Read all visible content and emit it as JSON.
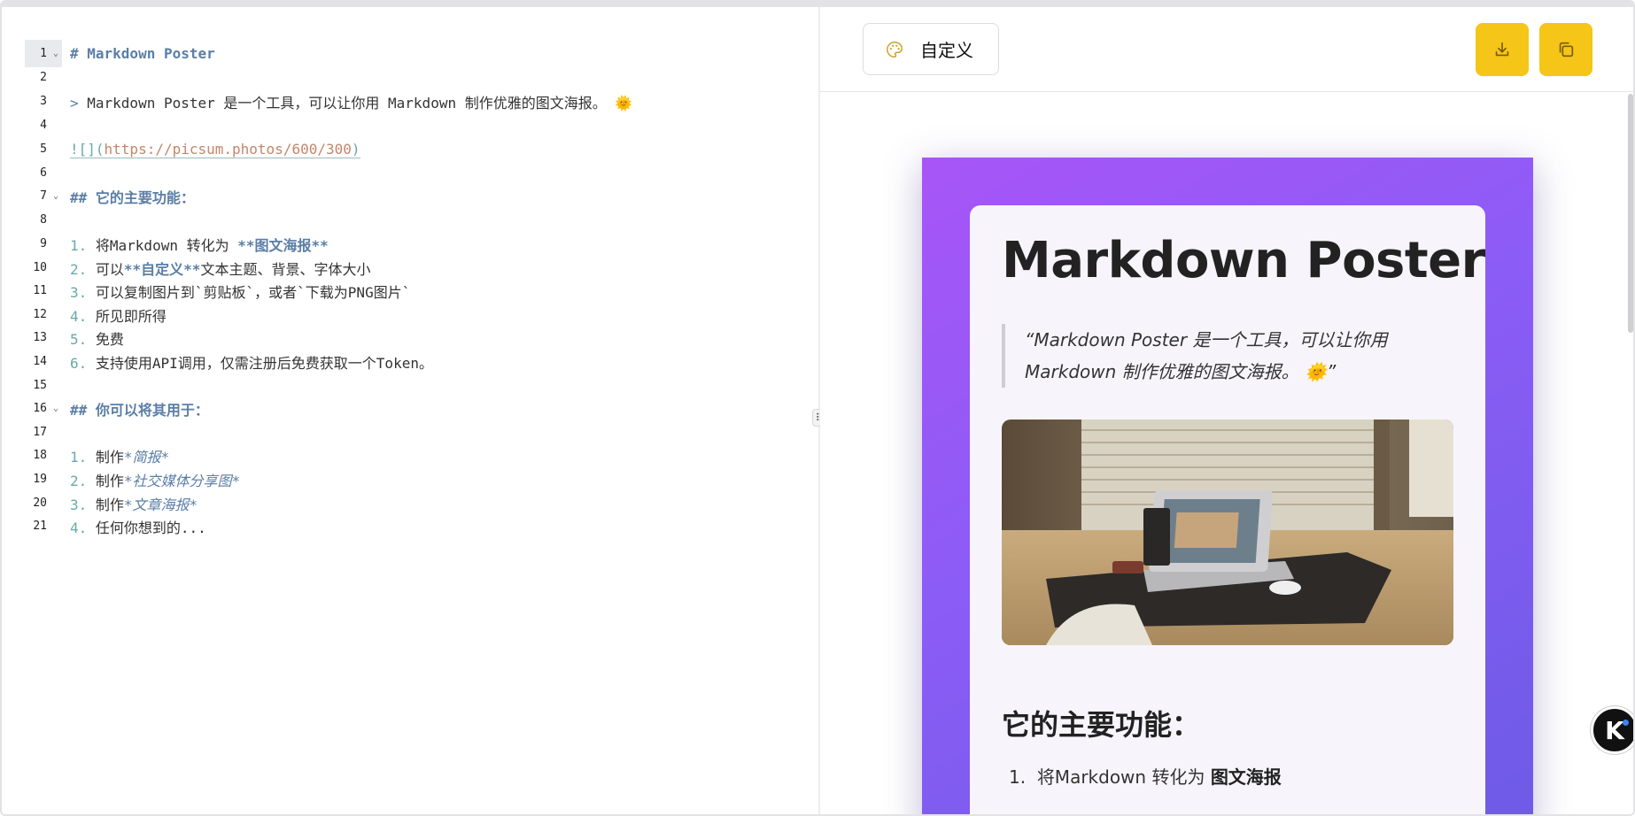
{
  "editor": {
    "lines": [
      {
        "n": "1"
      },
      {
        "n": "2"
      },
      {
        "n": "3"
      },
      {
        "n": "4"
      },
      {
        "n": "5"
      },
      {
        "n": "6"
      },
      {
        "n": "7"
      },
      {
        "n": "8"
      },
      {
        "n": "9"
      },
      {
        "n": "10"
      },
      {
        "n": "11"
      },
      {
        "n": "12"
      },
      {
        "n": "13"
      },
      {
        "n": "14"
      },
      {
        "n": "15"
      },
      {
        "n": "16"
      },
      {
        "n": "17"
      },
      {
        "n": "18"
      },
      {
        "n": "19"
      },
      {
        "n": "20"
      },
      {
        "n": "21"
      }
    ],
    "l1": "# Markdown Poster",
    "l3_marker": "> ",
    "l3_text": "Markdown Poster 是一个工具，可以让你用 Markdown 制作优雅的图文海报。 ",
    "l3_emoji": "🌞",
    "l5_link": "![](",
    "l5_url": "https://picsum.photos/600/300",
    "l5_close": ")",
    "l7": "## 它的主要功能：",
    "l9_num": "1.",
    "l9_a": " 将Markdown 转化为 ",
    "l9_b": "**图文海报**",
    "l10_num": "2.",
    "l10_a": " 可以",
    "l10_b": "**自定义**",
    "l10_c": "文本主题、背景、字体大小",
    "l11_num": "3.",
    "l11_a": " 可以复制图片到`剪贴板`，或者`下载为PNG图片`",
    "l12_num": "4.",
    "l12_a": " 所见即所得",
    "l13_num": "5.",
    "l13_a": " 免费",
    "l14_num": "6.",
    "l14_a": " 支持使用API调用，仅需注册后免费获取一个Token。",
    "l16": "## 你可以将其用于：",
    "l18_num": "1.",
    "l18_a": " 制作",
    "l18_b": "*简报*",
    "l19_num": "2.",
    "l19_a": " 制作",
    "l19_b": "*社交媒体分享图*",
    "l20_num": "3.",
    "l20_a": " 制作",
    "l20_b": "*文章海报*",
    "l21_num": "4.",
    "l21_a": " 任何你想到的..."
  },
  "toolbar": {
    "custom_label": "自定义",
    "palette_icon": "palette-icon",
    "download_icon": "download-icon",
    "copy_icon": "copy-icon",
    "accent": "#f5c518"
  },
  "poster": {
    "title": "Markdown Poster",
    "quote": "“Markdown Poster 是一个工具，可以让你用 Markdown 制作优雅的图文海报。 🌞”",
    "section_title": "它的主要功能：",
    "item1_num": "1.",
    "item1_text": "将Markdown 转化为 ",
    "item1_bold": "图文海报",
    "gradient_start": "#a855f7",
    "gradient_end": "#6d5be6"
  },
  "badge": {
    "label": "K"
  }
}
